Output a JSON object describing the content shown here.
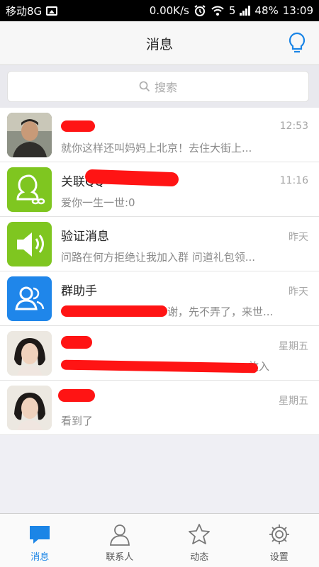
{
  "status": {
    "carrier": "移动8G",
    "speed": "0.00K/s",
    "battery": "48%",
    "time": "13:09",
    "sim": "5"
  },
  "header": {
    "title": "消息"
  },
  "search": {
    "placeholder": "搜索"
  },
  "conversations": [
    {
      "name": "",
      "time": "12:53",
      "preview": "就你这样还叫妈妈上北京！去住大街上..."
    },
    {
      "name": "关联QQ",
      "time": "11:16",
      "preview": "爱你一生一世:0"
    },
    {
      "name": "验证消息",
      "time": "昨天",
      "preview": "问路在何方拒绝让我加入群 问道礼包领..."
    },
    {
      "name": "群助手",
      "time": "昨天",
      "preview": "谢，先不弄了，来世..."
    },
    {
      "name": "",
      "time": "星期五",
      "preview": "放入"
    },
    {
      "name": "",
      "time": "星期五",
      "preview": "看到了"
    }
  ],
  "tabs": [
    {
      "label": "消息",
      "icon": "chat-icon",
      "active": true
    },
    {
      "label": "联系人",
      "icon": "contacts-icon",
      "active": false
    },
    {
      "label": "动态",
      "icon": "star-icon",
      "active": false
    },
    {
      "label": "设置",
      "icon": "gear-icon",
      "active": false
    }
  ],
  "colors": {
    "accent": "#1b85e6",
    "green": "#7fc620",
    "blue": "#1f86ea",
    "redaction": "#ff1414"
  }
}
